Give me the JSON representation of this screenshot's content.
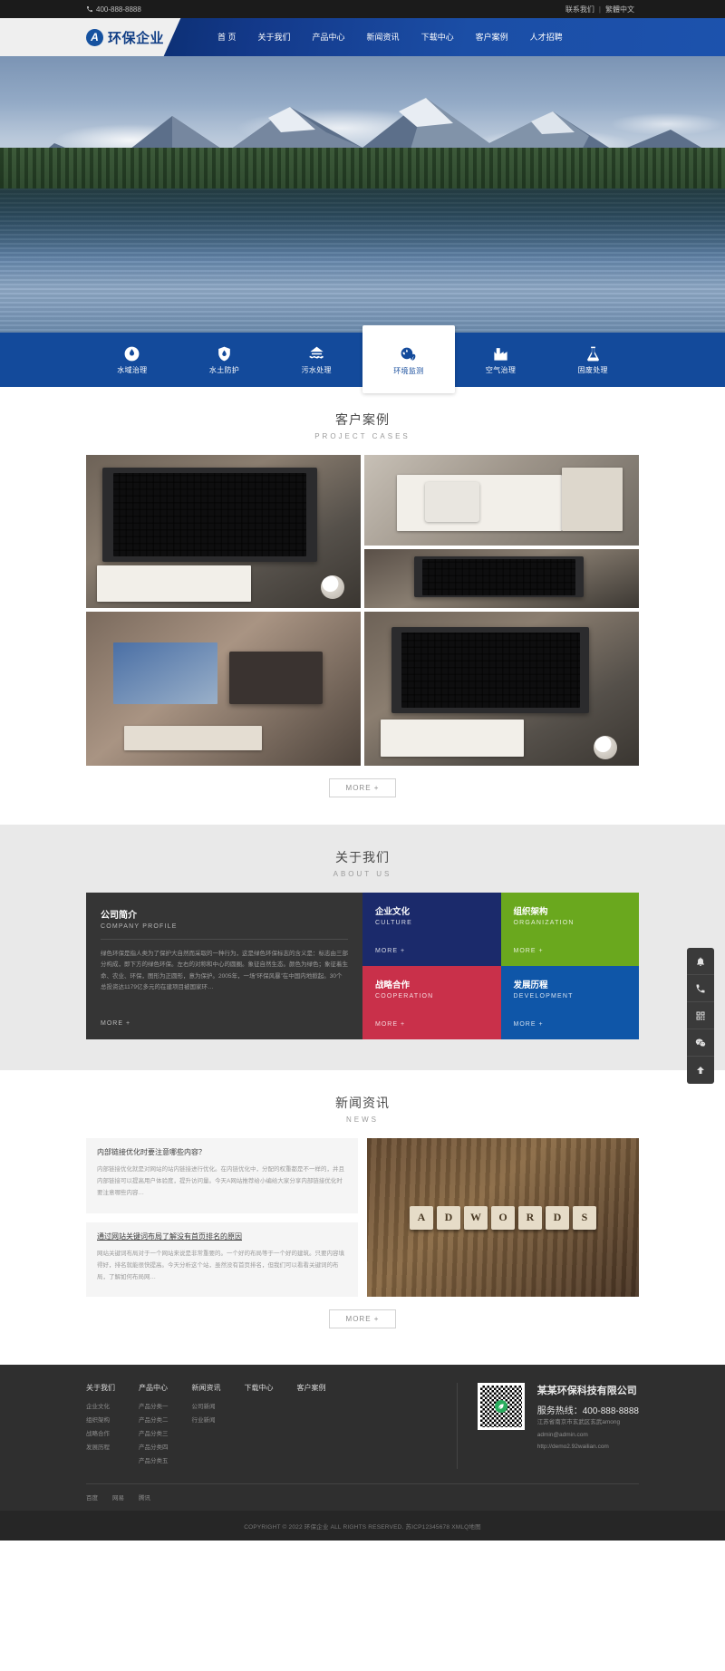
{
  "topbar": {
    "phone": "400-888-8888",
    "phone_icon": "phone-icon",
    "contact_link": "联系我们",
    "separator": "|",
    "lang_link": "繁體中文"
  },
  "header": {
    "logo_mark": "A",
    "logo_name": "环保企业",
    "nav": [
      {
        "label": "首 页"
      },
      {
        "label": "关于我们"
      },
      {
        "label": "产品中心"
      },
      {
        "label": "新闻资讯"
      },
      {
        "label": "下载中心"
      },
      {
        "label": "客户案例"
      },
      {
        "label": "人才招聘"
      }
    ]
  },
  "services": [
    {
      "label": "水域治理",
      "icon": "water-drop-circle-icon",
      "active": false
    },
    {
      "label": "水土防护",
      "icon": "shield-drop-icon",
      "active": false
    },
    {
      "label": "污水处理",
      "icon": "house-water-icon",
      "active": false
    },
    {
      "label": "环境监测",
      "icon": "globe-leaf-icon",
      "active": true
    },
    {
      "label": "空气治理",
      "icon": "pm25-factory-icon",
      "active": false
    },
    {
      "label": "固废处理",
      "icon": "flask-icon",
      "active": false
    }
  ],
  "cases": {
    "title_cn": "客户案例",
    "title_en": "PROJECT CASES",
    "more_label": "MORE +",
    "items": [
      {
        "name": "case-laptop-notebook"
      },
      {
        "name": "case-phone-notebook"
      },
      {
        "name": "case-desk-monitor"
      },
      {
        "name": "case-macbook-coffee"
      }
    ]
  },
  "about": {
    "title_cn": "关于我们",
    "title_en": "ABOUT US",
    "profile": {
      "title_cn": "公司简介",
      "title_en": "COMPANY PROFILE",
      "body": "绿色环保是指人类为了保护大自然而采取的一种行为，这是绿色环保标志的含义是：标志由三部分构成，即下方的绿色环保。左右的对称和中心的圆圈。象征自然生态。颜色为绿色；象征着生命、农业、环保，图形为正圆形，意为保护。2005年，一场“环保风暴”在中国内地掀起。30个总投资达1179亿多元的在建项目被国家环…",
      "more_label": "MORE +"
    },
    "tiles": [
      {
        "title_cn": "企业文化",
        "title_en": "CULTURE",
        "more_label": "MORE +",
        "color": "#1b2a6b"
      },
      {
        "title_cn": "组织架构",
        "title_en": "ORGANIZATION",
        "more_label": "MORE +",
        "color": "#6aa81e"
      },
      {
        "title_cn": "战略合作",
        "title_en": "COOPERATION",
        "more_label": "MORE +",
        "color": "#c9304a"
      },
      {
        "title_cn": "发展历程",
        "title_en": "DEVELOPMENT",
        "more_label": "MORE +",
        "color": "#0f56a8"
      }
    ]
  },
  "news": {
    "title_cn": "新闻资讯",
    "title_en": "NEWS",
    "more_label": "MORE +",
    "items": [
      {
        "title": "内部链接优化时要注意哪些内容？",
        "body": "内部链接优化就是对网站的站内链接进行优化。在内链优化中，分配的权重都是不一样的，并且内部链接可以提高用户体验度，提升访问量。今天A网站推荐给小编给大家分享内部链接优化时要注意哪些内容…"
      },
      {
        "title": "通过网站关键词布局了解没有首页排名的原因",
        "body": "网站关键词布局对于一个网站来说是非常重要的。一个好的布局等于一个好的建筑。只要内容填得好，排名就能很快提高。今天分析这个站，虽然没有首页排名，但我们可以看看关键词的布局，了解如何布局网…"
      }
    ],
    "image_word": "ADWORDS",
    "image_name": "adwords-wood-tiles"
  },
  "footer": {
    "columns": [
      {
        "heading": "关于我们",
        "links": [
          "企业文化",
          "组织架构",
          "战略合作",
          "发展历程"
        ]
      },
      {
        "heading": "产品中心",
        "links": [
          "产品分类一",
          "产品分类二",
          "产品分类三",
          "产品分类四",
          "产品分类五"
        ]
      },
      {
        "heading": "新闻资讯",
        "links": [
          "公司新闻",
          "行业新闻"
        ]
      },
      {
        "heading": "下载中心",
        "links": []
      },
      {
        "heading": "客户案例",
        "links": []
      }
    ],
    "qr_name": "wechat-qr-code",
    "company_name": "某某环保科技有限公司",
    "hotline_label": "服务热线：",
    "hotline": "400-888-8888",
    "address": "江苏省南京市玄武区玄武among",
    "email": "admin@admin.com",
    "website": "http://demo2.92wailian.com",
    "friend_links": [
      "百度",
      "网易",
      "腾讯"
    ],
    "copyright": "COPYRIGHT © 2022 环保企业 ALL RIGHTS RESERVED. 苏ICP12345678 XMLQ地图"
  },
  "floatbar": [
    {
      "icon": "bell-icon",
      "name": "notice-button"
    },
    {
      "icon": "phone-icon",
      "name": "call-button"
    },
    {
      "icon": "qrcode-icon",
      "name": "qrcode-button"
    },
    {
      "icon": "wechat-icon",
      "name": "wechat-button"
    },
    {
      "icon": "arrow-up-icon",
      "name": "back-to-top-button"
    }
  ]
}
